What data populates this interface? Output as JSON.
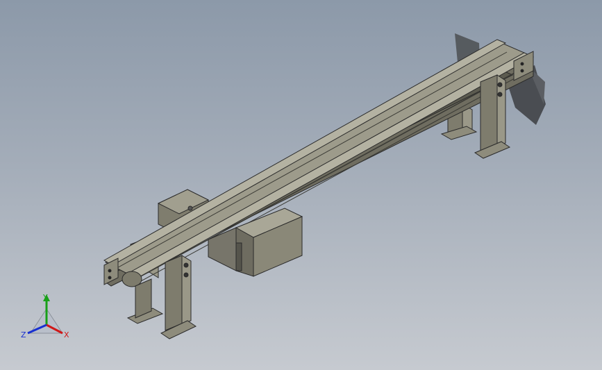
{
  "viewport": {
    "background_top": "#8c99a9",
    "background_bottom": "#c6cad0"
  },
  "model": {
    "name": "belt-conveyor-assembly",
    "part_color": "#8e8c7c",
    "shadow_color": "#505357",
    "edge_color": "#2a2a2a"
  },
  "triad": {
    "x_label": "X",
    "y_label": "Y",
    "z_label": "Z",
    "x_color": "#d01818",
    "y_color": "#18a018",
    "z_color": "#1830d0"
  }
}
